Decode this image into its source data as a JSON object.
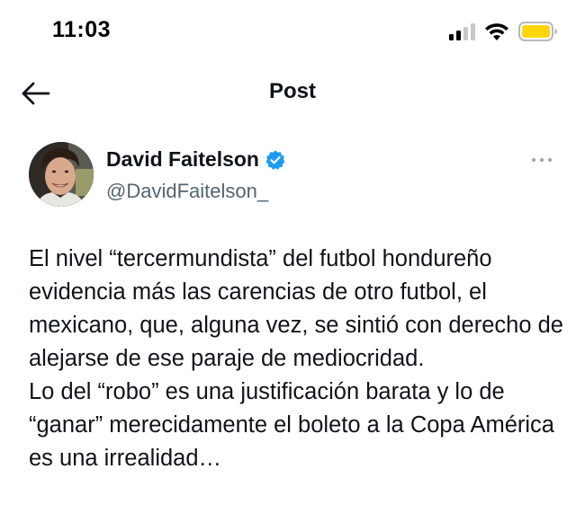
{
  "status_bar": {
    "time": "11:03",
    "icons": [
      "signal-icon",
      "wifi-icon",
      "battery-icon"
    ],
    "battery_color": "#ffd60a"
  },
  "header": {
    "back_icon": "arrow-left-icon",
    "title": "Post"
  },
  "author": {
    "display_name": "David Faitelson",
    "handle": "@DavidFaitelson_",
    "verified": true,
    "verified_color": "#1d9bf0",
    "more_icon": "more-horizontal-icon"
  },
  "post": {
    "paragraphs": [
      "El nivel “tercermundista” del futbol hondureño evidencia más las carencias de otro futbol, el mexicano, que, alguna vez, se sintió con derecho de alejarse de ese paraje de mediocridad.",
      "Lo del “robo” es una justificación barata y lo de “ganar” merecidamente el boleto a la Copa América es una irrealidad…"
    ]
  }
}
